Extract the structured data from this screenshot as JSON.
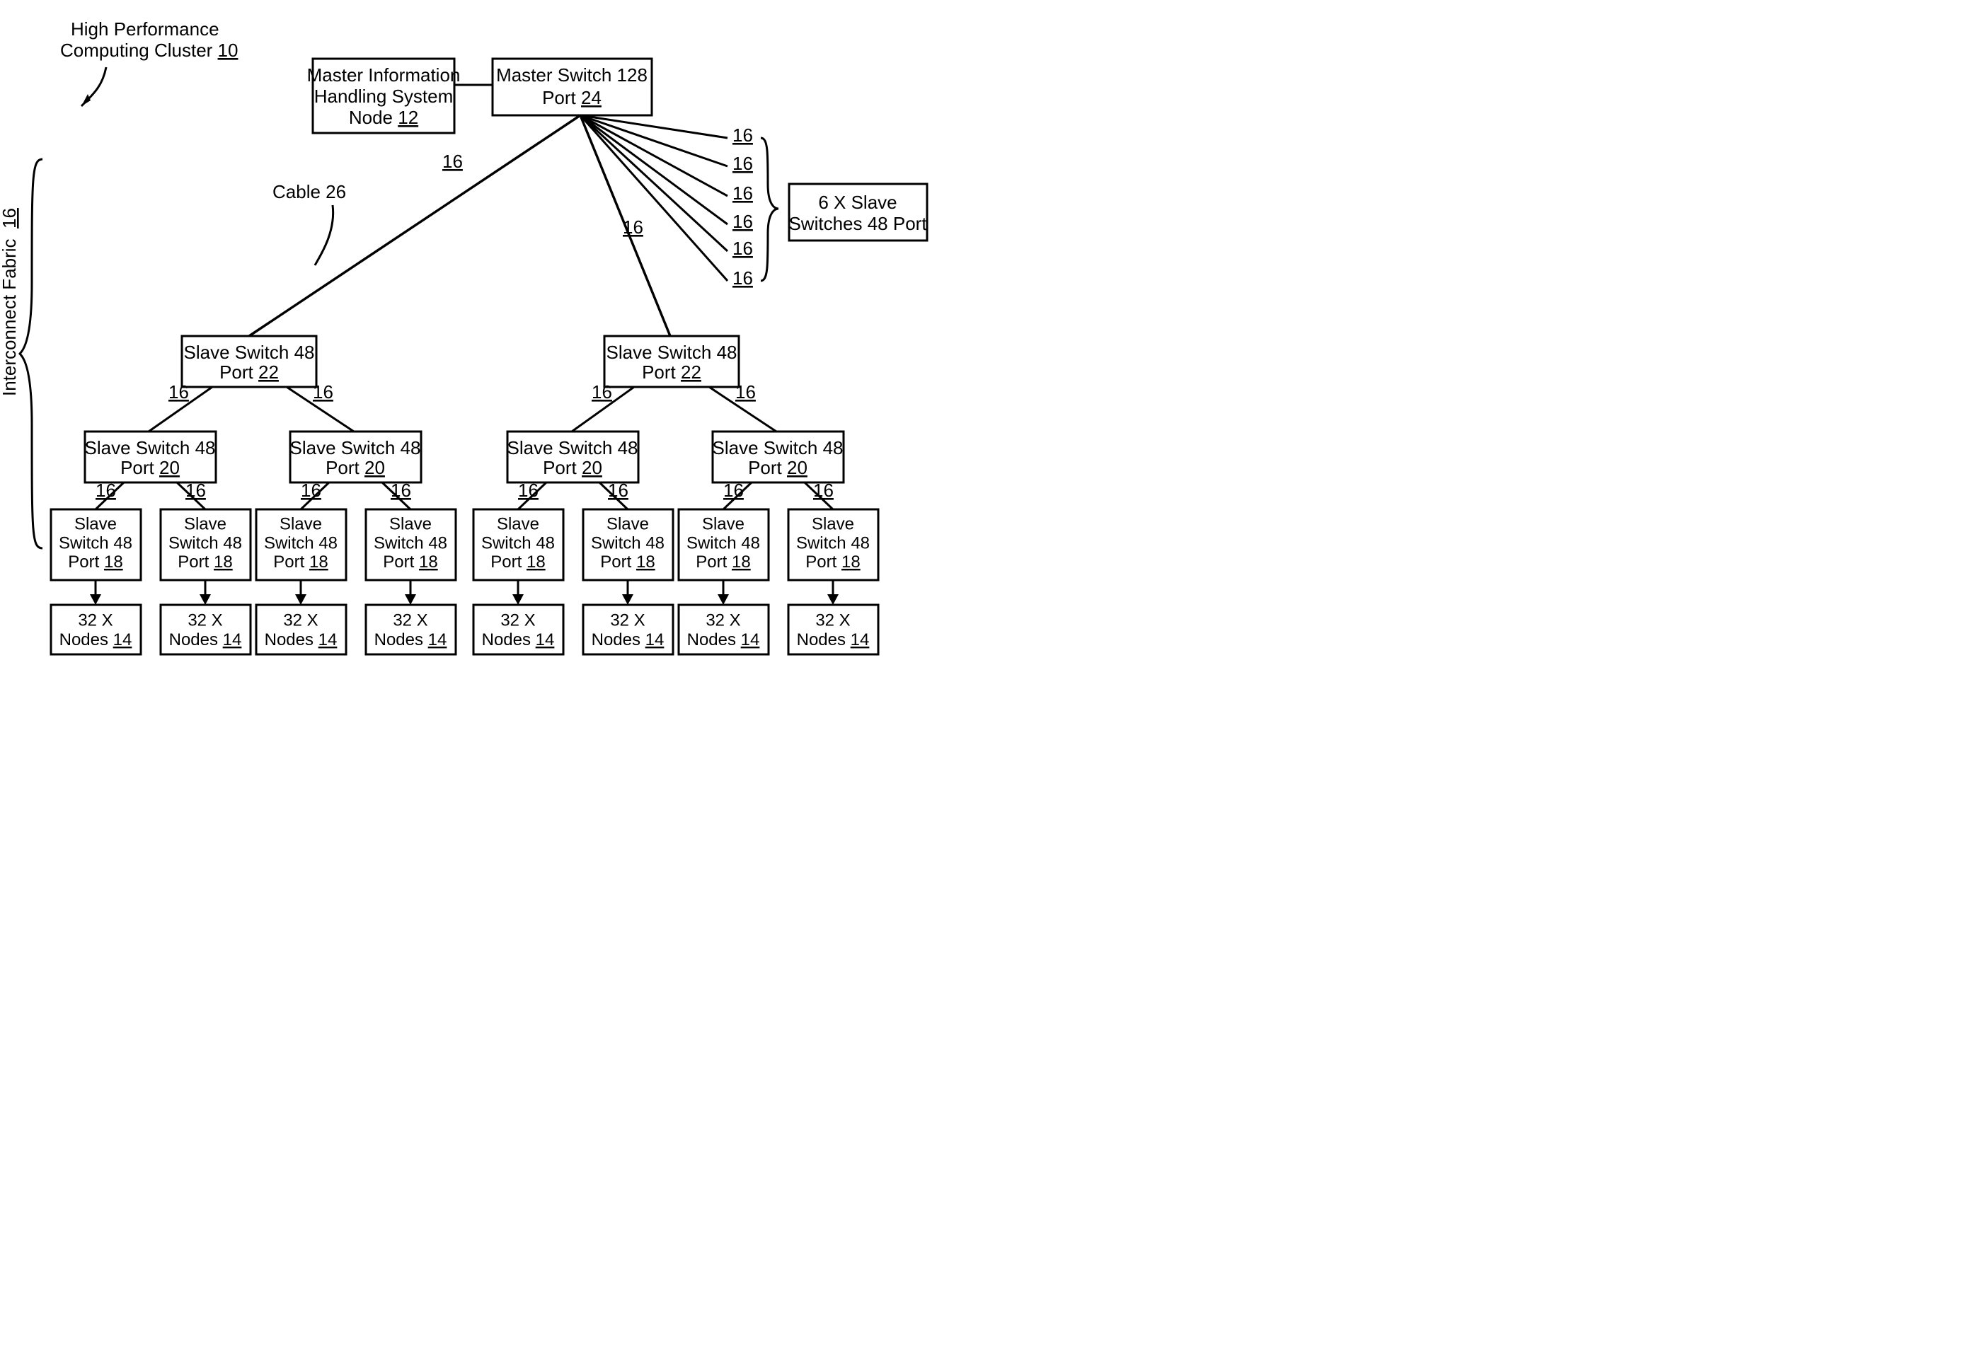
{
  "title": {
    "line1": "High Performance",
    "line2": "Computing Cluster",
    "ref": "10"
  },
  "side_label": {
    "text": "Interconnect Fabric",
    "ref": "16"
  },
  "master_node": {
    "line1": "Master Information",
    "line2": "Handling System",
    "line3": "Node",
    "ref": "12"
  },
  "master_switch": {
    "line1": "Master Switch 128",
    "line2": "Port",
    "ref": "24"
  },
  "cable_label": {
    "text": "Cable 26"
  },
  "edge_16": "16",
  "extra_switches": {
    "line1": "6 X Slave",
    "line2": "Switches 48 Port"
  },
  "slave_switch_22": {
    "line1": "Slave Switch 48",
    "line2": "Port",
    "ref": "22"
  },
  "slave_switch_20": {
    "line1": "Slave Switch 48",
    "line2": "Port",
    "ref": "20"
  },
  "slave_switch_18": {
    "line1": "Slave",
    "line2": "Switch 48",
    "line3": "Port",
    "ref": "18"
  },
  "nodes_14": {
    "line1": "32 X",
    "line2": "Nodes",
    "ref": "14"
  }
}
